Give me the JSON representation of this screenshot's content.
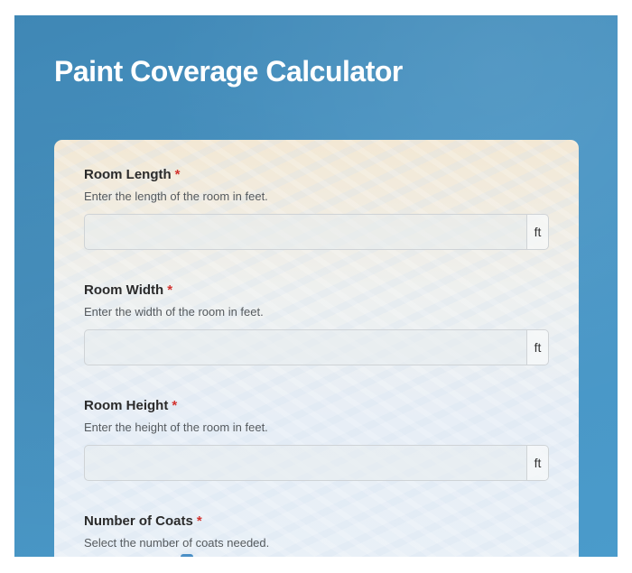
{
  "header": {
    "title": "Paint Coverage Calculator"
  },
  "fields": [
    {
      "label": "Room Length",
      "required_mark": "*",
      "hint": "Enter the length of the room in feet.",
      "value": "",
      "unit": "ft"
    },
    {
      "label": "Room Width",
      "required_mark": "*",
      "hint": "Enter the width of the room in feet.",
      "value": "",
      "unit": "ft"
    },
    {
      "label": "Room Height",
      "required_mark": "*",
      "hint": "Enter the height of the room in feet.",
      "value": "",
      "unit": "ft"
    }
  ],
  "coats": {
    "label": "Number of Coats",
    "required_mark": "*",
    "hint": "Select the number of coats needed."
  },
  "colors": {
    "accent": "#4a8fc6",
    "required": "#d2332f",
    "background": "#4893c2"
  }
}
